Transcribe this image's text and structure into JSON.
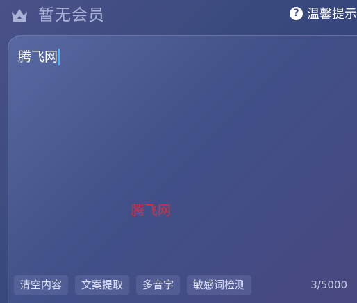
{
  "header": {
    "membership_status": "暂无会员",
    "crown_icon": "crown-icon",
    "help_icon": "question-circle-icon",
    "help_icon_glyph": "?",
    "tips_label": "温馨提示"
  },
  "editor": {
    "text_value": "腾飞网",
    "watermark": "腾飞网",
    "caret_color": "#3fb6ff",
    "watermark_color": "#d83040"
  },
  "actions": [
    {
      "label": "清空内容"
    },
    {
      "label": "文案提取"
    },
    {
      "label": "多音字"
    },
    {
      "label": "敏感词检测"
    }
  ],
  "counter": "3/5000"
}
